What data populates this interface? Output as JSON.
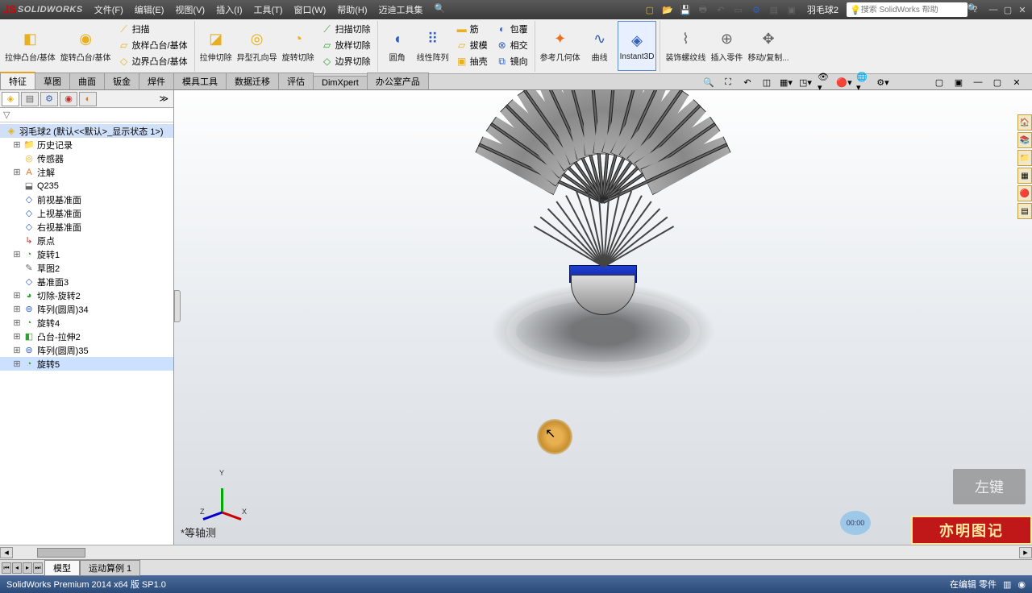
{
  "app": {
    "logo_text": "SOLIDWORKS",
    "doc_name": "羽毛球2",
    "search_placeholder": "搜索 SolidWorks 帮助"
  },
  "menu": {
    "file": "文件(F)",
    "edit": "编辑(E)",
    "view": "视图(V)",
    "insert": "插入(I)",
    "tools": "工具(T)",
    "window": "窗口(W)",
    "help": "帮助(H)",
    "maidi": "迈迪工具集"
  },
  "ribbon": {
    "extrude": "拉伸凸台/基体",
    "revolve": "旋转凸台/基体",
    "sweep": "扫描",
    "loft": "放样凸台/基体",
    "boundary": "边界凸台/基体",
    "cut_extrude": "拉伸切除",
    "hole": "异型孔向导",
    "cut_revolve": "旋转切除",
    "cut_sweep": "扫描切除",
    "cut_loft": "放样切除",
    "cut_boundary": "边界切除",
    "fillet": "圆角",
    "pattern": "线性阵列",
    "rib": "筋",
    "draft": "拔模",
    "shell": "抽壳",
    "wrap": "包覆",
    "intersect": "相交",
    "mirror": "镜向",
    "refgeom": "参考几何体",
    "curves": "曲线",
    "instant3d": "Instant3D",
    "decor": "装饰螺纹线",
    "insert_part": "插入零件",
    "move_copy": "移动/复制..."
  },
  "tabs": {
    "features": "特征",
    "sketch": "草图",
    "surface": "曲面",
    "sheetmetal": "钣金",
    "weldment": "焊件",
    "moldtools": "模具工具",
    "datamigrate": "数据迁移",
    "evaluate": "评估",
    "dimxpert": "DimXpert",
    "office": "办公室产品"
  },
  "tree": {
    "root": "羽毛球2  (默认<<默认>_显示状态 1>)",
    "history": "历史记录",
    "sensors": "传感器",
    "annotations": "注解",
    "material": "Q235",
    "front": "前视基准面",
    "top": "上视基准面",
    "right": "右视基准面",
    "origin": "原点",
    "revolve1": "旋转1",
    "sketch2": "草图2",
    "plane3": "基准面3",
    "cutrevolve2": "切除-旋转2",
    "pattern34": "阵列(圆周)34",
    "revolve4": "旋转4",
    "bosse2": "凸台-拉伸2",
    "pattern35": "阵列(圆周)35",
    "revolve5": "旋转5"
  },
  "viewport": {
    "orientation": "*等轴测",
    "y_label": "Y",
    "x_label": "X",
    "z_label": "Z",
    "timer": "00:00"
  },
  "overlay": {
    "click_hint": "左键",
    "watermark": "亦明图记"
  },
  "bottom_tabs": {
    "model": "模型",
    "motion1": "运动算例 1"
  },
  "status": {
    "left": "SolidWorks Premium 2014 x64 版 SP1.0",
    "right": "在编辑 零件"
  }
}
